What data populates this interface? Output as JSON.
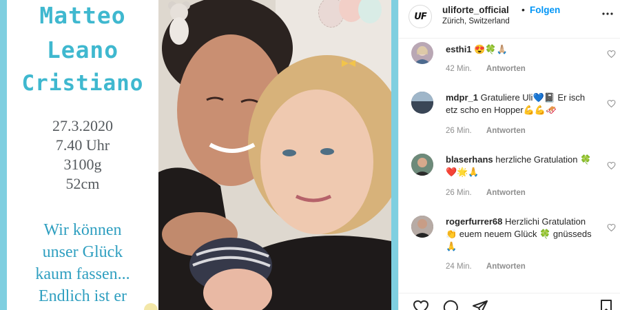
{
  "post_image": {
    "name_line_1": "Matteo",
    "name_line_2": "Leano",
    "name_line_3": "Cristiano",
    "date": "27.3.2020",
    "time": "7.40 Uhr",
    "weight": "3100g",
    "length": "52cm",
    "message_lines": [
      "Wir können",
      "unser Glück",
      "kaum fassen...",
      "Endlich ist er"
    ],
    "colors": {
      "frame": "#7fcfe0",
      "script": "#3fb8cf",
      "message": "#2f9fc0"
    }
  },
  "header": {
    "avatar_text": "UF",
    "username": "uliforte_official",
    "separator": "•",
    "follow_label": "Folgen",
    "location": "Zürich, Switzerland",
    "more_icon": "more-horizontal-icon"
  },
  "comments": [
    {
      "username": "esthi1",
      "text": "😍🍀🙏🏼",
      "time": "42 Min.",
      "reply_label": "Antworten",
      "avatar_color": "#b9a7b4"
    },
    {
      "username": "mdpr_1",
      "text": "Gratuliere Uli💙📓 Er isch etz scho en Hopper💪💪🛷",
      "time": "26 Min.",
      "reply_label": "Antworten",
      "avatar_color": "#2e3a4a"
    },
    {
      "username": "blaserhans",
      "text": "herzliche Gratulation 🍀❤️🌟🙏",
      "time": "26 Min.",
      "reply_label": "Antworten",
      "avatar_color": "#8a6e5c"
    },
    {
      "username": "rogerfurrer68",
      "text": "Herzlichi Gratulation 👏 euem neuem Glück 🍀 gnüsseds 🙏",
      "time": "24 Min.",
      "reply_label": "Antworten",
      "avatar_color": "#5a4a48"
    }
  ],
  "actions": {
    "like_icon": "heart-icon",
    "comment_icon": "comment-icon",
    "share_icon": "send-icon",
    "save_icon": "bookmark-icon"
  }
}
